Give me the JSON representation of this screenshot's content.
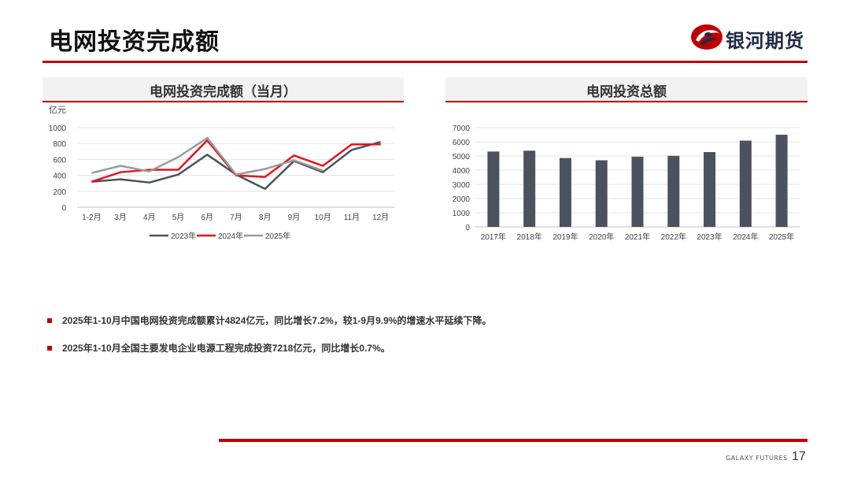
{
  "header": {
    "title": "电网投资完成额",
    "logo_text": "银河期货",
    "brand_color": "#c00000"
  },
  "left_panel": {
    "title": "电网投资完成额（当月）",
    "unit": "亿元"
  },
  "right_panel": {
    "title": "电网投资总额"
  },
  "chart_data": [
    {
      "type": "line",
      "title": "电网投资完成额（当月）",
      "ylabel": "亿元",
      "categories": [
        "1-2月",
        "3月",
        "4月",
        "5月",
        "6月",
        "7月",
        "8月",
        "9月",
        "10月",
        "11月",
        "12月"
      ],
      "ylim": [
        0,
        1000
      ],
      "yticks": [
        0,
        200,
        400,
        600,
        800,
        1000
      ],
      "grid": true,
      "legend_position": "bottom",
      "series": [
        {
          "name": "2023年",
          "color": "#4a5260",
          "values": [
            320,
            350,
            310,
            410,
            660,
            410,
            230,
            580,
            440,
            720,
            820
          ]
        },
        {
          "name": "2024年",
          "color": "#e0161f",
          "values": [
            320,
            440,
            470,
            470,
            840,
            400,
            380,
            650,
            520,
            790,
            790
          ]
        },
        {
          "name": "2025年",
          "color": "#9a9a9a",
          "values": [
            430,
            520,
            450,
            630,
            870,
            410,
            480,
            590,
            460,
            null,
            null
          ]
        }
      ]
    },
    {
      "type": "bar",
      "title": "电网投资总额",
      "categories": [
        "2017年",
        "2018年",
        "2019年",
        "2020年",
        "2021年",
        "2022年",
        "2023年",
        "2024年",
        "2025年"
      ],
      "values": [
        5315,
        5373,
        4856,
        4699,
        4951,
        5012,
        5275,
        6083,
        6500
      ],
      "ylim": [
        0,
        7000
      ],
      "yticks": [
        0,
        1000,
        2000,
        3000,
        4000,
        5000,
        6000,
        7000
      ],
      "grid": true,
      "color": "#4a5260"
    }
  ],
  "bullets": [
    "2025年1-10月中国电网投资完成额累计4824亿元，同比增长7.2%，较1-9月9.9%的增速水平延续下降。",
    "2025年1-10月全国主要发电企业电源工程完成投资7218亿元，同比增长0.7%。"
  ],
  "footer": {
    "brand": "GALAXY FUTURES",
    "page_number": "17"
  }
}
